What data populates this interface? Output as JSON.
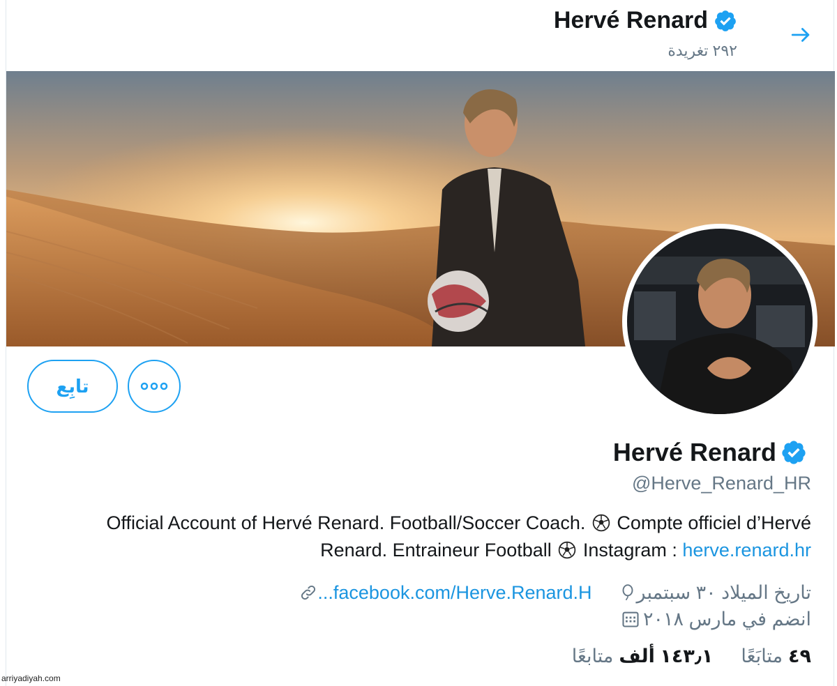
{
  "header": {
    "name": "Hervé Renard",
    "tweet_count": "٢٩٢ تغريدة",
    "back_icon": "arrow-right-icon"
  },
  "actions": {
    "follow_label": "تابِع",
    "more_icon": "more-dots-icon"
  },
  "profile": {
    "name": "Hervé Renard",
    "handle": "@Herve_Renard_HR",
    "bio_line1": "Official Account of Hervé Renard. Football/Soccer Coach.",
    "bio_line1b": "Compte officiel d’Hervé",
    "bio_line2a": "Renard. Entraineur Football",
    "bio_line2b": "Instagram :",
    "bio_link": "herve.renard.hr",
    "birthday": "تاريخ الميلاد ٣٠ سبتمبر",
    "website": "facebook.com/Herve.Renard.H...",
    "joined": "انضم في مارس ٢٠١٨"
  },
  "stats": {
    "following_count": "٤٩",
    "following_label": "متابَعًا",
    "followers_count": "١٤٣٫١ ألف",
    "followers_label": "متابعًا"
  },
  "watermark": "arriyadiyah.com",
  "colors": {
    "accent": "#1da1f2",
    "link": "#1b95e0",
    "muted": "#657786",
    "text": "#14171a"
  }
}
